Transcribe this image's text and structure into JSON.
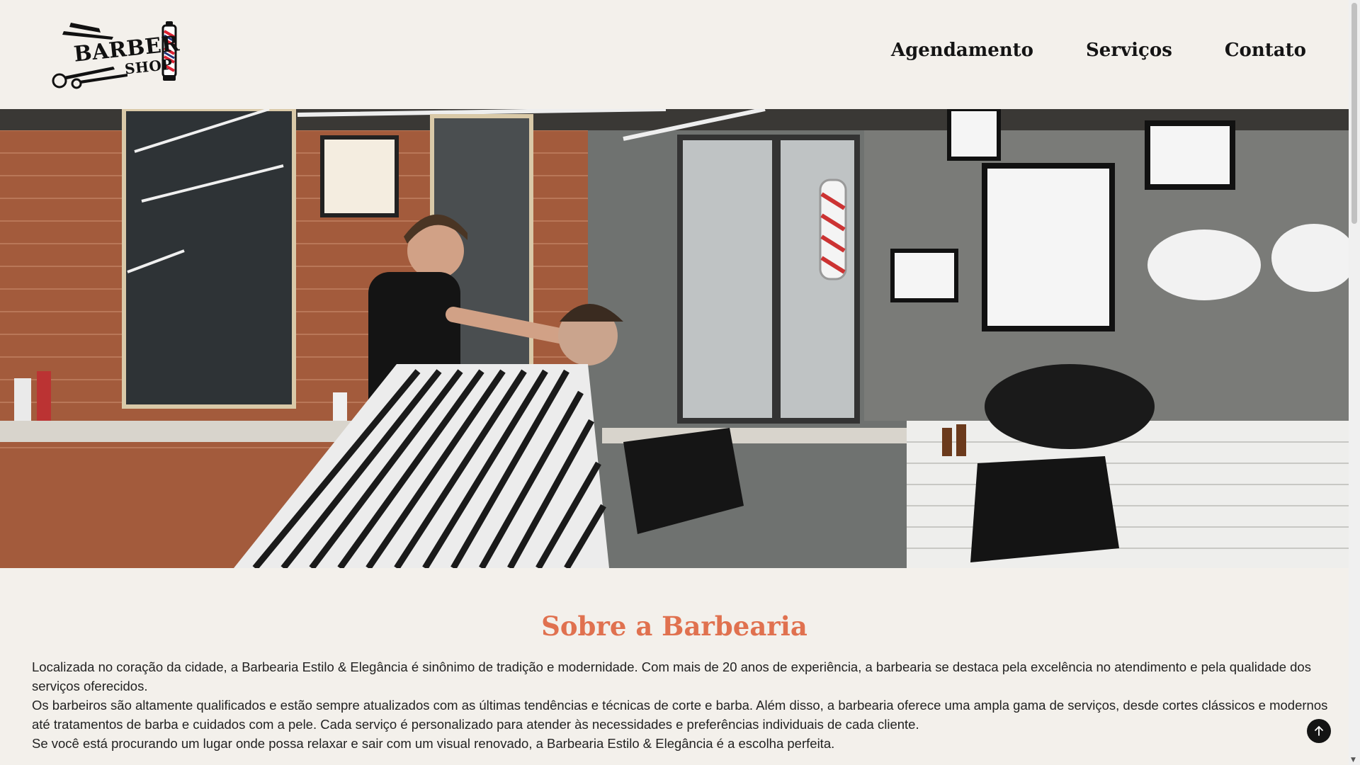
{
  "header": {
    "logo": {
      "line1": "BARBER",
      "line2": "SHOP"
    },
    "nav": [
      {
        "label": "Agendamento"
      },
      {
        "label": "Serviços"
      },
      {
        "label": "Contato"
      }
    ]
  },
  "hero": {
    "icon": "barbershop-photo"
  },
  "about": {
    "title": "Sobre a Barbearia",
    "paragraphs": [
      "Localizada no coração da cidade, a Barbearia Estilo & Elegância é sinônimo de tradição e modernidade. Com mais de 20 anos de experiência, a barbearia se destaca pela excelência no atendimento e pela qualidade dos serviços oferecidos.",
      "Os barbeiros são altamente qualificados e estão sempre atualizados com as últimas tendências e técnicas de corte e barba. Além disso, a barbearia oferece uma ampla gama de serviços, desde cortes clássicos e modernos até tratamentos de barba e cuidados com a pele. Cada serviço é personalizado para atender às necessidades e preferências individuais de cada cliente.",
      "Se você está procurando um lugar onde possa relaxar e sair com um visual renovado, a Barbearia Estilo & Elegância é a escolha perfeita."
    ]
  },
  "colors": {
    "background": "#f3f0eb",
    "accent": "#e0714f",
    "text": "#141414"
  },
  "scroll_top": {
    "icon": "arrow-up-icon"
  }
}
